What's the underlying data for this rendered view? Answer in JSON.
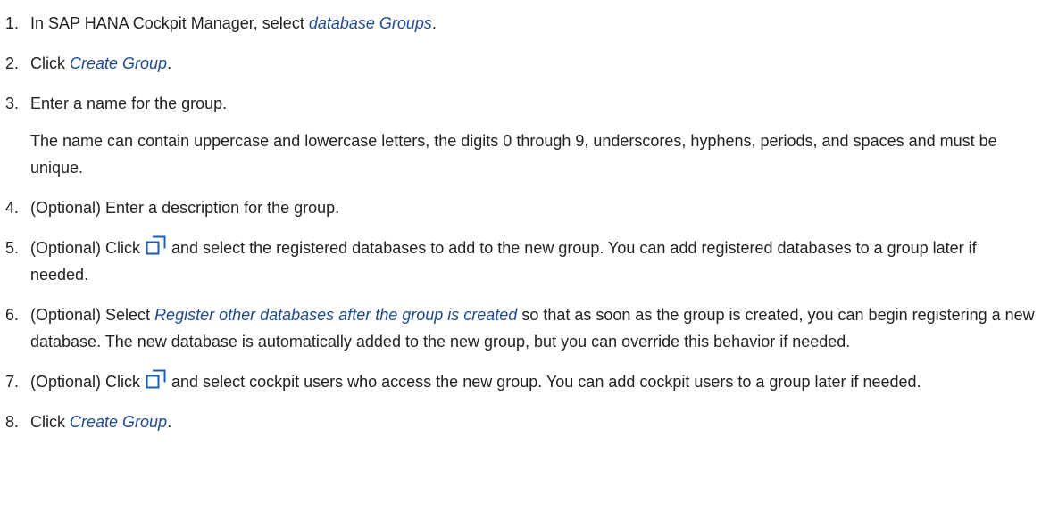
{
  "steps": [
    {
      "num": "1.",
      "parts": [
        "In SAP HANA Cockpit Manager, select ",
        "database Groups",
        "."
      ]
    },
    {
      "num": "2.",
      "parts": [
        "Click ",
        "Create Group",
        "."
      ]
    },
    {
      "num": "3.",
      "text": "Enter a name for the group.",
      "note": "The name can contain uppercase and lowercase letters, the digits 0 through 9, underscores, hyphens, periods, and spaces and must be unique."
    },
    {
      "num": "4.",
      "text": "(Optional) Enter a description for the group."
    },
    {
      "num": "5.",
      "parts": [
        "(Optional) Click ",
        " and select the registered databases to add to the new group. You can add registered databases to a group later if needed."
      ]
    },
    {
      "num": "6.",
      "parts": [
        "(Optional) Select ",
        "Register other databases after the group is created",
        " so that as soon as the group is created, you can begin registering a new database. The new database is automatically added to the new group, but you can override this behavior if needed."
      ]
    },
    {
      "num": "7.",
      "parts": [
        "(Optional) Click ",
        " and select cockpit users who access the new group. You can add cockpit users to a group later if needed."
      ]
    },
    {
      "num": "8.",
      "parts": [
        "Click ",
        "Create Group",
        "."
      ]
    }
  ],
  "icons": {
    "value_help": "value-help-icon"
  },
  "colors": {
    "ui_term": "#1e4b8e",
    "text": "#222222",
    "icon": "#1e5bb5"
  }
}
